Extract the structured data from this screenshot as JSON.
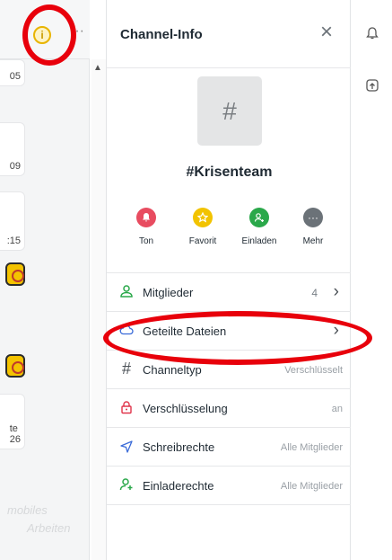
{
  "chat_strip": {
    "cards": [
      {
        "text": "05"
      },
      {
        "text": "09"
      },
      {
        "text": ":15"
      },
      {
        "text": "te\n26"
      }
    ],
    "wallpaper": [
      "mobiles",
      "Arbeiten"
    ]
  },
  "panel": {
    "title": "Channel-Info",
    "avatar_glyph": "#",
    "channel_name": "#Krisenteam",
    "actions": [
      {
        "label": "Ton",
        "icon": "bell-icon",
        "color": "#e84c60"
      },
      {
        "label": "Favorit",
        "icon": "star-icon",
        "color": "#f2c300"
      },
      {
        "label": "Einladen",
        "icon": "add-user-icon",
        "color": "#2aa84a"
      },
      {
        "label": "Mehr",
        "icon": "more-icon",
        "color": "#6b7278"
      }
    ],
    "rows": [
      {
        "label": "Mitglieder",
        "value": "4",
        "icon": "members-icon",
        "color": "#2aa84a"
      },
      {
        "label": "Geteilte Dateien",
        "value": "",
        "icon": "cloud-icon",
        "color": "#3a6bd8"
      },
      {
        "label": "Channeltyp",
        "value": "Verschlüsselt",
        "icon": "hash-icon",
        "color": "#4a5056"
      },
      {
        "label": "Verschlüsselung",
        "value": "an",
        "icon": "lock-icon",
        "color": "#e0344a"
      },
      {
        "label": "Schreibrechte",
        "value": "Alle Mitglieder",
        "icon": "send-icon",
        "color": "#3a6bd8"
      },
      {
        "label": "Einladerechte",
        "value": "Alle Mitglieder",
        "icon": "add-user-icon",
        "color": "#2aa84a"
      }
    ]
  },
  "colors": {
    "annotation": "#e8000b",
    "accent_green": "#2aa84a"
  }
}
